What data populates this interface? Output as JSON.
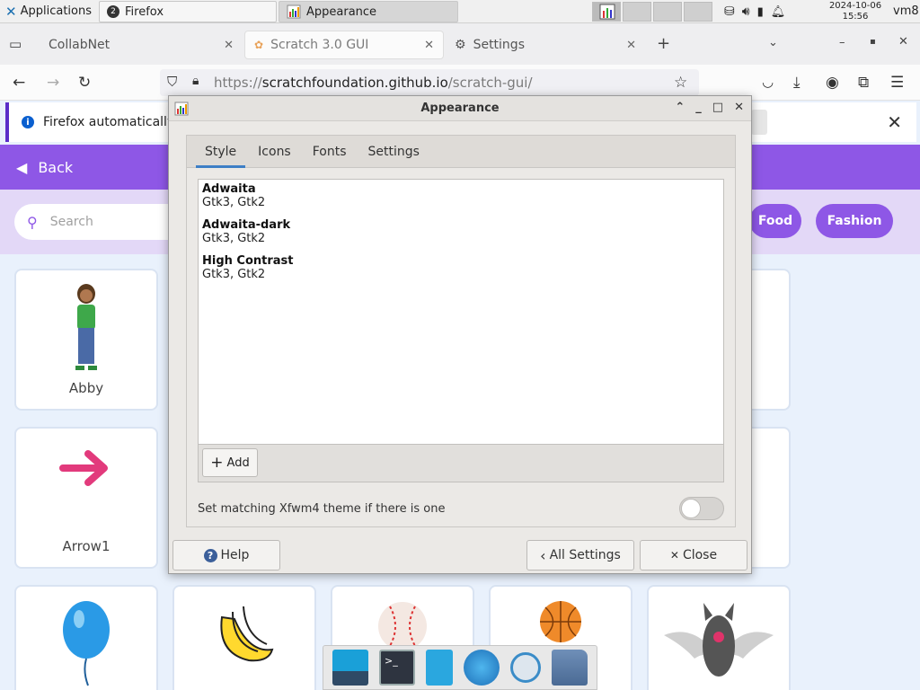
{
  "taskbar": {
    "applications_label": "Applications",
    "firefox_task_label": "Firefox",
    "firefox_task_count": "2",
    "appearance_task_label": "Appearance",
    "date": "2024-10-06",
    "time": "15:56",
    "host": "vm8"
  },
  "browser": {
    "tabs": [
      {
        "label": "CollabNet"
      },
      {
        "label": "Scratch 3.0 GUI"
      },
      {
        "label": "Settings"
      }
    ],
    "url_scheme": "https://",
    "url_host": "scratchfoundation.github.io",
    "url_path": "/scratch-gui/",
    "notification_text": "Firefox automatically"
  },
  "scratch": {
    "back_label": "Back",
    "search_placeholder": "Search",
    "pills": [
      "Food",
      "Fashion"
    ],
    "cards": [
      {
        "label": "Abby"
      },
      {
        "label": "Arrow1"
      }
    ]
  },
  "dialog": {
    "title": "Appearance",
    "tabs": [
      "Style",
      "Icons",
      "Fonts",
      "Settings"
    ],
    "themes": [
      {
        "name": "Adwaita",
        "support": "Gtk3, Gtk2"
      },
      {
        "name": "Adwaita-dark",
        "support": "Gtk3, Gtk2"
      },
      {
        "name": "High Contrast",
        "support": "Gtk3, Gtk2"
      }
    ],
    "add_label": "Add",
    "match_label": "Set matching Xfwm4 theme if there is one",
    "help_label": "Help",
    "all_settings_label": "All Settings",
    "close_label": "Close"
  },
  "colors": {
    "scratch_purple": "#8e57e6",
    "scratch_bg": "#e9f1fc",
    "dialog_bg": "#ebe9e6",
    "accent_blue": "#3d7fc6"
  }
}
